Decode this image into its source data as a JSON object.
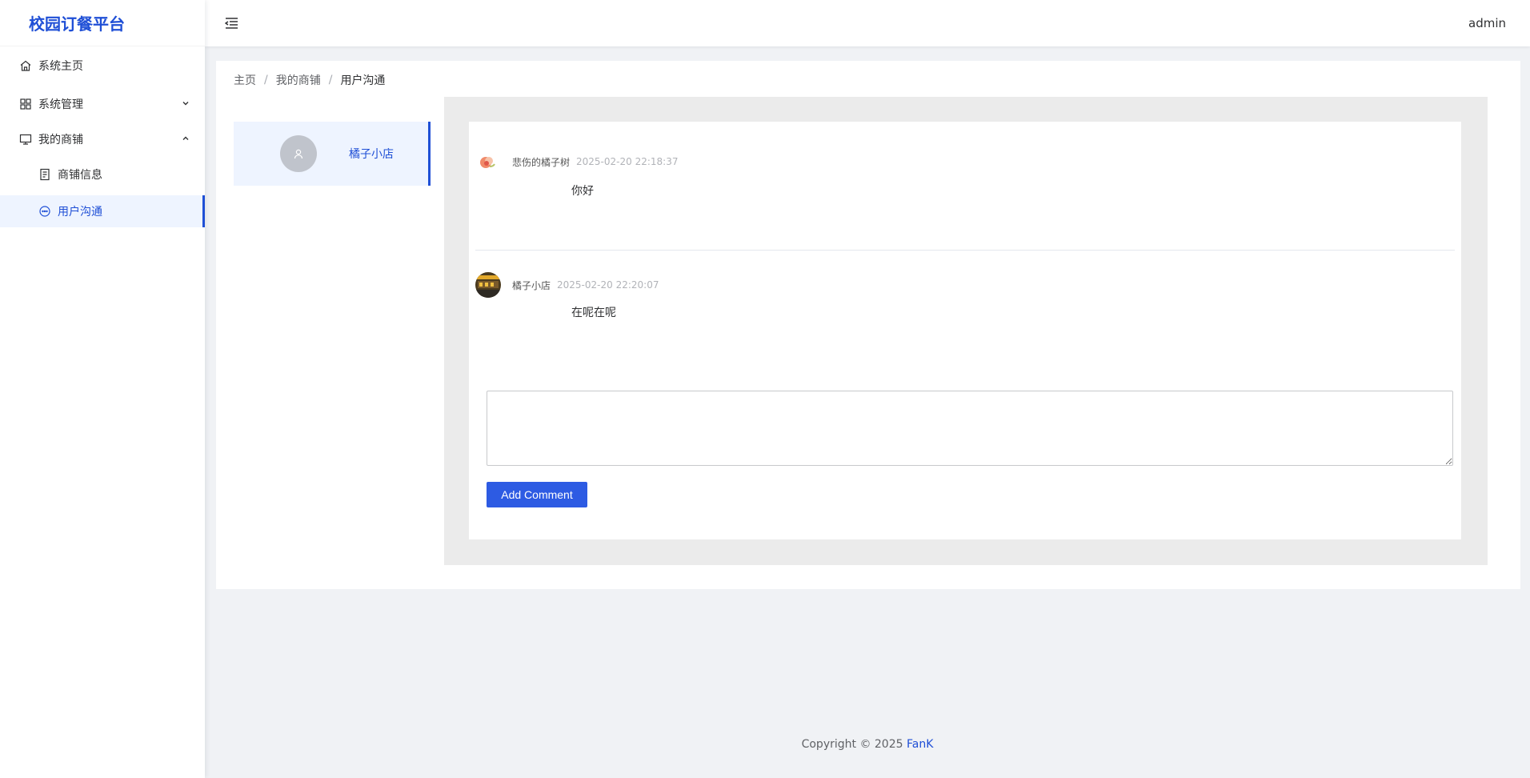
{
  "sidebar": {
    "logo": "校园订餐平台",
    "items": [
      {
        "label": "系统主页",
        "icon": "home-icon"
      },
      {
        "label": "系统管理",
        "icon": "grid-icon",
        "arrow": "chevron-down-icon"
      },
      {
        "label": "我的商铺",
        "icon": "monitor-icon",
        "arrow": "chevron-up-icon"
      },
      {
        "label": "商铺信息",
        "icon": "document-icon"
      },
      {
        "label": "用户沟通",
        "icon": "chat-icon",
        "active": true
      }
    ]
  },
  "header": {
    "user": "admin"
  },
  "breadcrumb": {
    "items": [
      "主页",
      "我的商铺",
      "用户沟通"
    ],
    "separator": "/"
  },
  "contacts": [
    {
      "name": "橘子小店",
      "avatar": "default-user-icon",
      "selected": true
    }
  ],
  "messages": [
    {
      "author": "悲伤的橘子树",
      "time": "2025-02-20 22:18:37",
      "text": "你好",
      "avatar": "peach-avatar"
    },
    {
      "author": "橘子小店",
      "time": "2025-02-20 22:20:07",
      "text": "在呢在呢",
      "avatar": "shop-avatar"
    }
  ],
  "composer": {
    "value": "",
    "button_label": "Add Comment"
  },
  "footer": {
    "copyright": "Copyright © 2025",
    "author": "FanK"
  },
  "colors": {
    "accent": "#1f4fd6",
    "button": "#2d5be3",
    "active_bg": "#eef4ff",
    "chat_frame": "#ebebeb"
  }
}
